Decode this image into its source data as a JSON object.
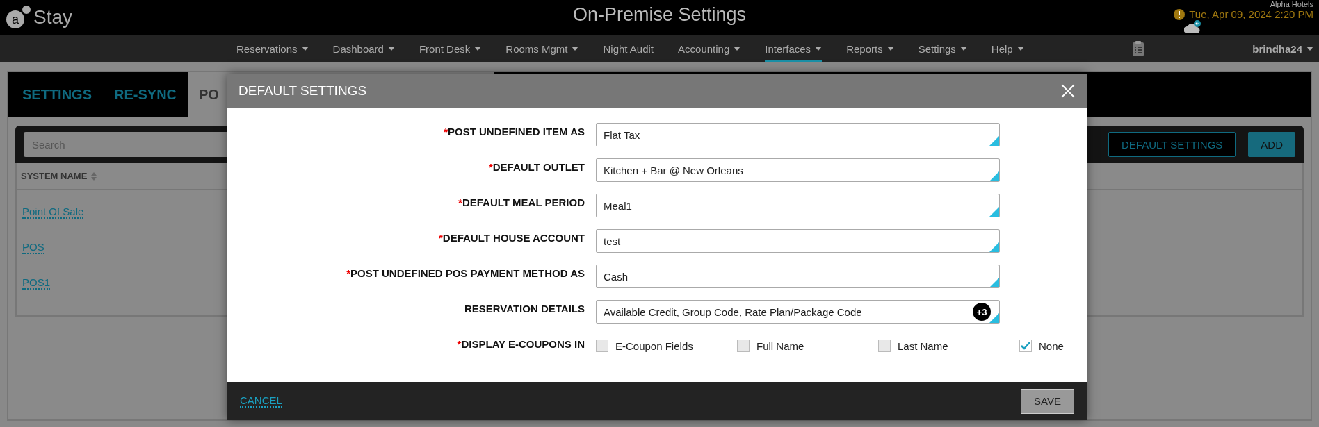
{
  "header": {
    "logo_mark": "a",
    "logo_text": "Stay",
    "title": "On-Premise Settings",
    "hotel": "Alpha Hotels",
    "datetime": "Tue, Apr 09, 2024 2:20 PM"
  },
  "nav": {
    "items": [
      {
        "label": "Reservations",
        "has_menu": true,
        "selected": false
      },
      {
        "label": "Dashboard",
        "has_menu": true,
        "selected": false
      },
      {
        "label": "Front Desk",
        "has_menu": true,
        "selected": false
      },
      {
        "label": "Rooms Mgmt",
        "has_menu": true,
        "selected": false
      },
      {
        "label": "Night Audit",
        "has_menu": false,
        "selected": false
      },
      {
        "label": "Accounting",
        "has_menu": true,
        "selected": false
      },
      {
        "label": "Interfaces",
        "has_menu": true,
        "selected": true
      },
      {
        "label": "Reports",
        "has_menu": true,
        "selected": false
      },
      {
        "label": "Settings",
        "has_menu": true,
        "selected": false
      },
      {
        "label": "Help",
        "has_menu": true,
        "selected": false
      }
    ],
    "user": "brindha24"
  },
  "page": {
    "tabs": [
      {
        "label": "SETTINGS",
        "selected": false
      },
      {
        "label": "RE-SYNC",
        "selected": false
      },
      {
        "label": "PO",
        "selected": true
      }
    ],
    "search": {
      "placeholder": "Search"
    },
    "buttons": [
      {
        "label": "DEFAULT SETTINGS",
        "kind": "outline"
      },
      {
        "label": "ADD",
        "kind": "solid"
      }
    ],
    "table": {
      "columns": [
        "SYSTEM NAME"
      ],
      "rows": [
        "Point Of Sale",
        "POS",
        "POS1"
      ]
    }
  },
  "modal": {
    "title": "DEFAULT SETTINGS",
    "required_mark": "*",
    "fields": [
      {
        "label": "POST UNDEFINED ITEM AS",
        "required": true,
        "value": "Flat Tax"
      },
      {
        "label": "DEFAULT OUTLET",
        "required": true,
        "value": "Kitchen + Bar @ New Orleans"
      },
      {
        "label": "DEFAULT MEAL PERIOD",
        "required": true,
        "value": "Meal1"
      },
      {
        "label": "DEFAULT HOUSE ACCOUNT",
        "required": true,
        "value": "test"
      },
      {
        "label": "POST UNDEFINED POS PAYMENT METHOD AS",
        "required": true,
        "value": "Cash"
      },
      {
        "label": "RESERVATION DETAILS",
        "required": false,
        "value": "Available Credit, Group Code, Rate Plan/Package Code",
        "badge": "+3"
      }
    ],
    "coupons": {
      "label": "DISPLAY E-COUPONS IN",
      "required": true,
      "options": [
        {
          "label": "E-Coupon Fields",
          "checked": false
        },
        {
          "label": "Full Name",
          "checked": false
        },
        {
          "label": "Last Name",
          "checked": false
        },
        {
          "label": "None",
          "checked": true
        }
      ]
    },
    "cancel": "CANCEL",
    "save": "SAVE"
  }
}
